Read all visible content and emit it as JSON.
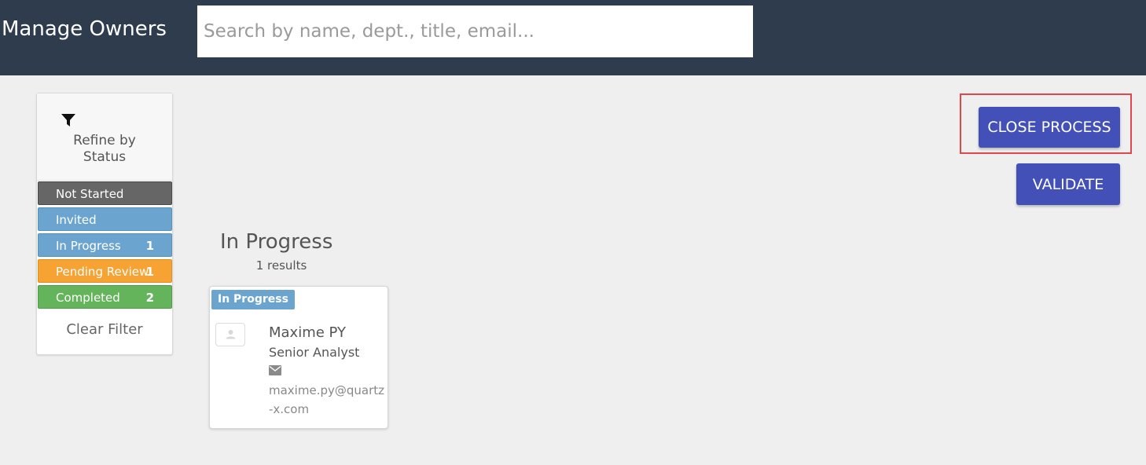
{
  "header": {
    "title": "Manage Owners",
    "search_placeholder": "Search by name, dept., title, email..."
  },
  "filter": {
    "title": "Refine by Status",
    "icon": "filter-icon",
    "statuses": [
      {
        "label": "Not Started",
        "count": "",
        "color": "#666666"
      },
      {
        "label": "Invited",
        "count": "",
        "color": "#6ba5cf"
      },
      {
        "label": "In Progress",
        "count": "1",
        "color": "#6ba5cf"
      },
      {
        "label": "Pending Review",
        "count": "1",
        "color": "#f7a334"
      },
      {
        "label": "Completed",
        "count": "2",
        "color": "#63b45a"
      }
    ],
    "clear_label": "Clear Filter"
  },
  "section": {
    "title": "In Progress",
    "results": "1 results"
  },
  "owners": [
    {
      "status": "In Progress",
      "name": "Maxime PY",
      "title": "Senior Analyst",
      "email": "maxime.py@quartz-x.com"
    }
  ],
  "actions": {
    "close_process_label": "CLOSE PROCESS",
    "validate_label": "VALIDATE",
    "accent_color": "#4350b8",
    "highlight_color": "#e0474c"
  }
}
